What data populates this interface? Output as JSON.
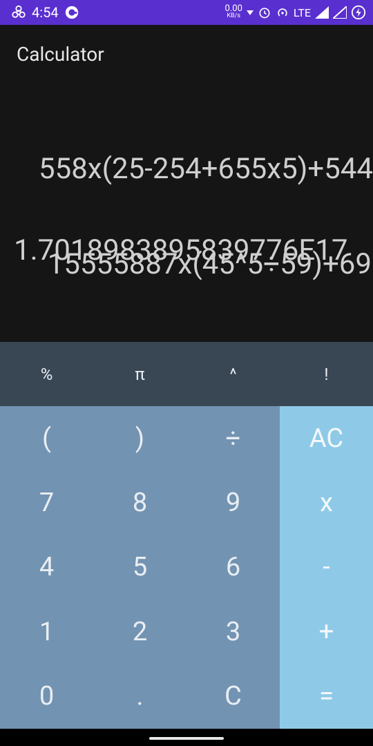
{
  "status_bar": {
    "time": "4:54",
    "speed_value": "0.00",
    "speed_unit": "KB/s",
    "network": "LTE"
  },
  "app": {
    "title": "Calculator"
  },
  "display": {
    "expression_line1": "558x(25-254+655x5)+544",
    "expression_line2": "15555887x(45^5÷59)+69",
    "result": "1.7018983895839776E17"
  },
  "keypad": {
    "scientific": [
      "%",
      "π",
      "^",
      "!"
    ],
    "numbers": [
      "(",
      ")",
      "÷",
      "7",
      "8",
      "9",
      "4",
      "5",
      "6",
      "1",
      "2",
      "3",
      "0",
      ".",
      "C"
    ],
    "operators": [
      "AC",
      "x",
      "-",
      "+",
      "="
    ]
  },
  "colors": {
    "status_bar": "#5a2fcf",
    "display_bg": "#151515",
    "scientific_row": "#394755",
    "number_pad": "#7393b2",
    "operator_pad": "#8ecae8"
  }
}
